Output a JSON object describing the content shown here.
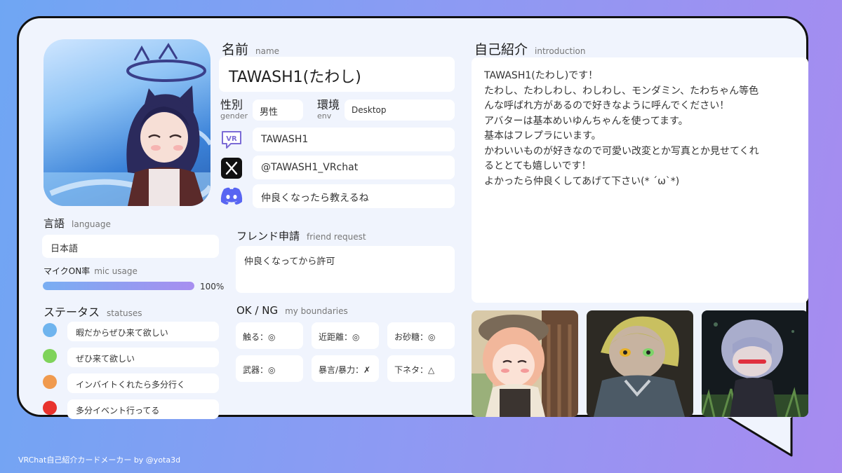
{
  "profile": {
    "name_label": "名前",
    "name_sub": "name",
    "name": "TAWASH1(たわし)",
    "gender_label": "性別",
    "gender_sub": "gender",
    "gender": "男性",
    "env_label": "環境",
    "env_sub": "env",
    "env": "Desktop",
    "vrchat_id": "TAWASH1",
    "x_handle": "@TAWASH1_VRchat",
    "discord": "仲良くなったら教えるね"
  },
  "language": {
    "label": "言語",
    "sub": "language",
    "value": "日本語"
  },
  "mic": {
    "label": "マイクON率",
    "sub": "mic usage",
    "percent_text": "100%",
    "fraction": 1.0
  },
  "statuses": {
    "label": "ステータス",
    "sub": "statuses",
    "items": [
      {
        "text": "暇だからぜひ来て欲しい",
        "color": "#6fb4ee"
      },
      {
        "text": "ぜひ来て欲しい",
        "color": "#7fd35a"
      },
      {
        "text": "インバイトくれたら多分行く",
        "color": "#f09a4e"
      },
      {
        "text": "多分イベント行ってる",
        "color": "#e8322d"
      }
    ]
  },
  "friend_request": {
    "label": "フレンド申請",
    "sub": "friend request",
    "value": "仲良くなってから許可"
  },
  "boundaries": {
    "label": "OK / NG",
    "sub": "my boundaries",
    "items": [
      "触る：◎",
      "近距離：◎",
      "お砂糖：◎",
      "武器：◎",
      "暴言/暴力：✗",
      "下ネタ：△"
    ]
  },
  "introduction": {
    "label": "自己紹介",
    "sub": "introduction",
    "lines": [
      "TAWASH1(たわし)です！",
      "たわし、たわしわし、わしわし、モンダミン、たわちゃん等色",
      "んな呼ばれ方があるので好きなように呼んでください！",
      "アバターは基本めいゆんちゃんを使ってます。",
      "基本はフレプラにいます。",
      "かわいいものが好きなので可愛い改変とか写真とか見せてくれ",
      "るととても嬉しいです！",
      "よかったら仲良くしてあげて下さい(* ´ω`*)"
    ]
  },
  "icons": {
    "vrchat": "vrchat-icon",
    "x": "x-icon",
    "discord": "discord-icon"
  },
  "footer": "VRChat自己紹介カードメーカー by @yota3d"
}
